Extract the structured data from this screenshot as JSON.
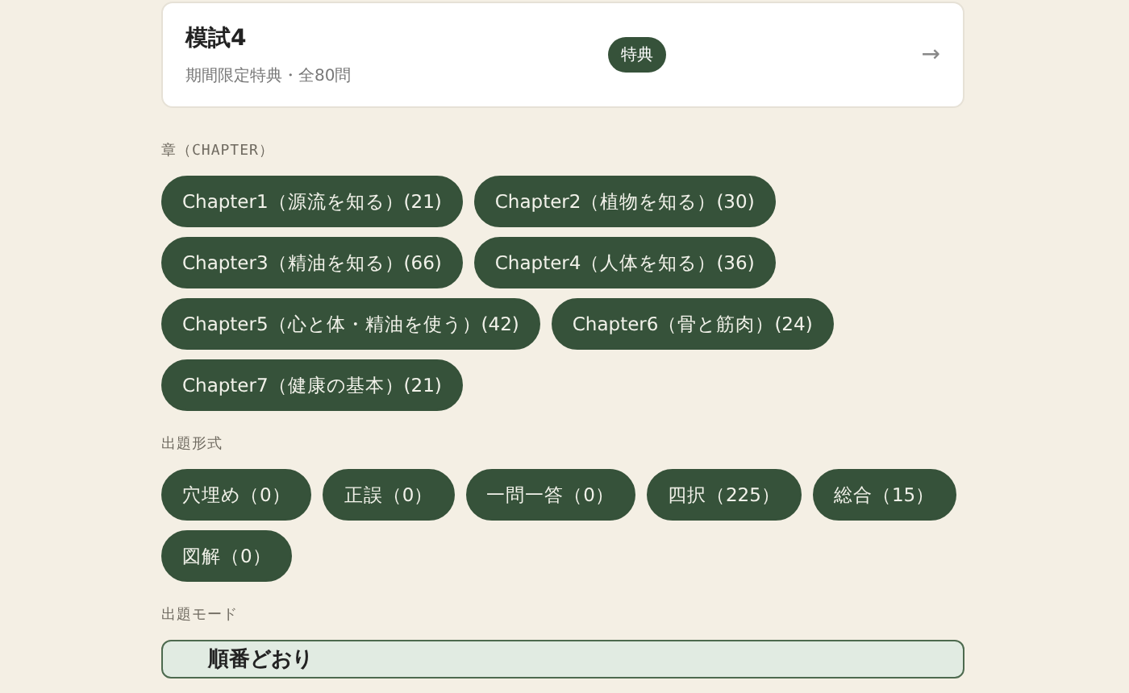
{
  "exam_card": {
    "title": "模試4",
    "subtitle": "期間限定特典・全80問",
    "badge": "特典",
    "arrow": "→"
  },
  "chapter_section": {
    "label": "章（CHAPTER）",
    "chips": [
      {
        "label": "Chapter1（源流を知る）(21)",
        "selected": true
      },
      {
        "label": "Chapter2（植物を知る）(30)",
        "selected": true
      },
      {
        "label": "Chapter3（精油を知る）(66)",
        "selected": true
      },
      {
        "label": "Chapter4（人体を知る）(36)",
        "selected": true
      },
      {
        "label": "Chapter5（心と体・精油を使う）(42)",
        "selected": true
      },
      {
        "label": "Chapter6（骨と筋肉）(24)",
        "selected": true
      },
      {
        "label": "Chapter7（健康の基本）(21)",
        "selected": true
      }
    ]
  },
  "format_section": {
    "label": "出題形式",
    "chips": [
      {
        "label": "穴埋め（0）",
        "selected": true
      },
      {
        "label": "正誤（0）",
        "selected": true
      },
      {
        "label": "一問一答（0）",
        "selected": true
      },
      {
        "label": "四択（225）",
        "selected": true
      },
      {
        "label": "総合（15）",
        "selected": true
      },
      {
        "label": "図解（0）",
        "selected": true
      }
    ]
  },
  "mode_section": {
    "label": "出題モード",
    "options": [
      {
        "title": "順番どおり",
        "selected": true
      }
    ]
  }
}
